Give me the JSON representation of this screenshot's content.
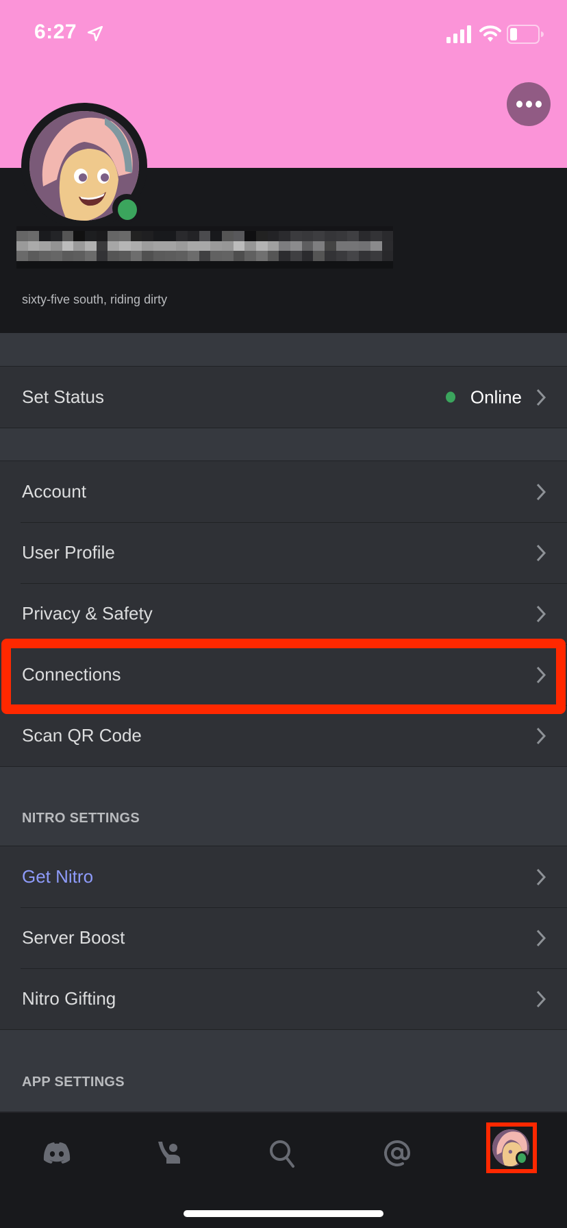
{
  "status_bar": {
    "time": "6:27",
    "icons": [
      "location-arrow-icon",
      "cellular-signal-icon",
      "wifi-icon",
      "battery-low-icon"
    ]
  },
  "profile": {
    "banner_color": "#FB94D8",
    "more_button_icon": "ellipsis-icon",
    "username": "[redacted / pixelated]",
    "bio": "sixty-five south, riding dirty",
    "presence": "online",
    "presence_color": "#3BA55D"
  },
  "status_row": {
    "label": "Set Status",
    "value": "Online"
  },
  "user_settings": {
    "items": [
      {
        "label": "Account"
      },
      {
        "label": "User Profile"
      },
      {
        "label": "Privacy & Safety"
      },
      {
        "label": "Connections",
        "highlighted": true
      },
      {
        "label": "Scan QR Code"
      }
    ]
  },
  "nitro_settings": {
    "header": "NITRO SETTINGS",
    "items": [
      {
        "label": "Get Nitro",
        "accent": "#8E9BFA"
      },
      {
        "label": "Server Boost"
      },
      {
        "label": "Nitro Gifting"
      }
    ]
  },
  "app_settings": {
    "header": "APP SETTINGS"
  },
  "tabbar": {
    "tabs": [
      {
        "name": "home",
        "icon": "discord-logo-icon"
      },
      {
        "name": "friends",
        "icon": "friends-wave-icon"
      },
      {
        "name": "search",
        "icon": "search-icon"
      },
      {
        "name": "mentions",
        "icon": "at-sign-icon"
      },
      {
        "name": "profile",
        "icon": "user-avatar",
        "active": true
      }
    ]
  },
  "annotations": {
    "highlight_color": "#FF2800"
  }
}
